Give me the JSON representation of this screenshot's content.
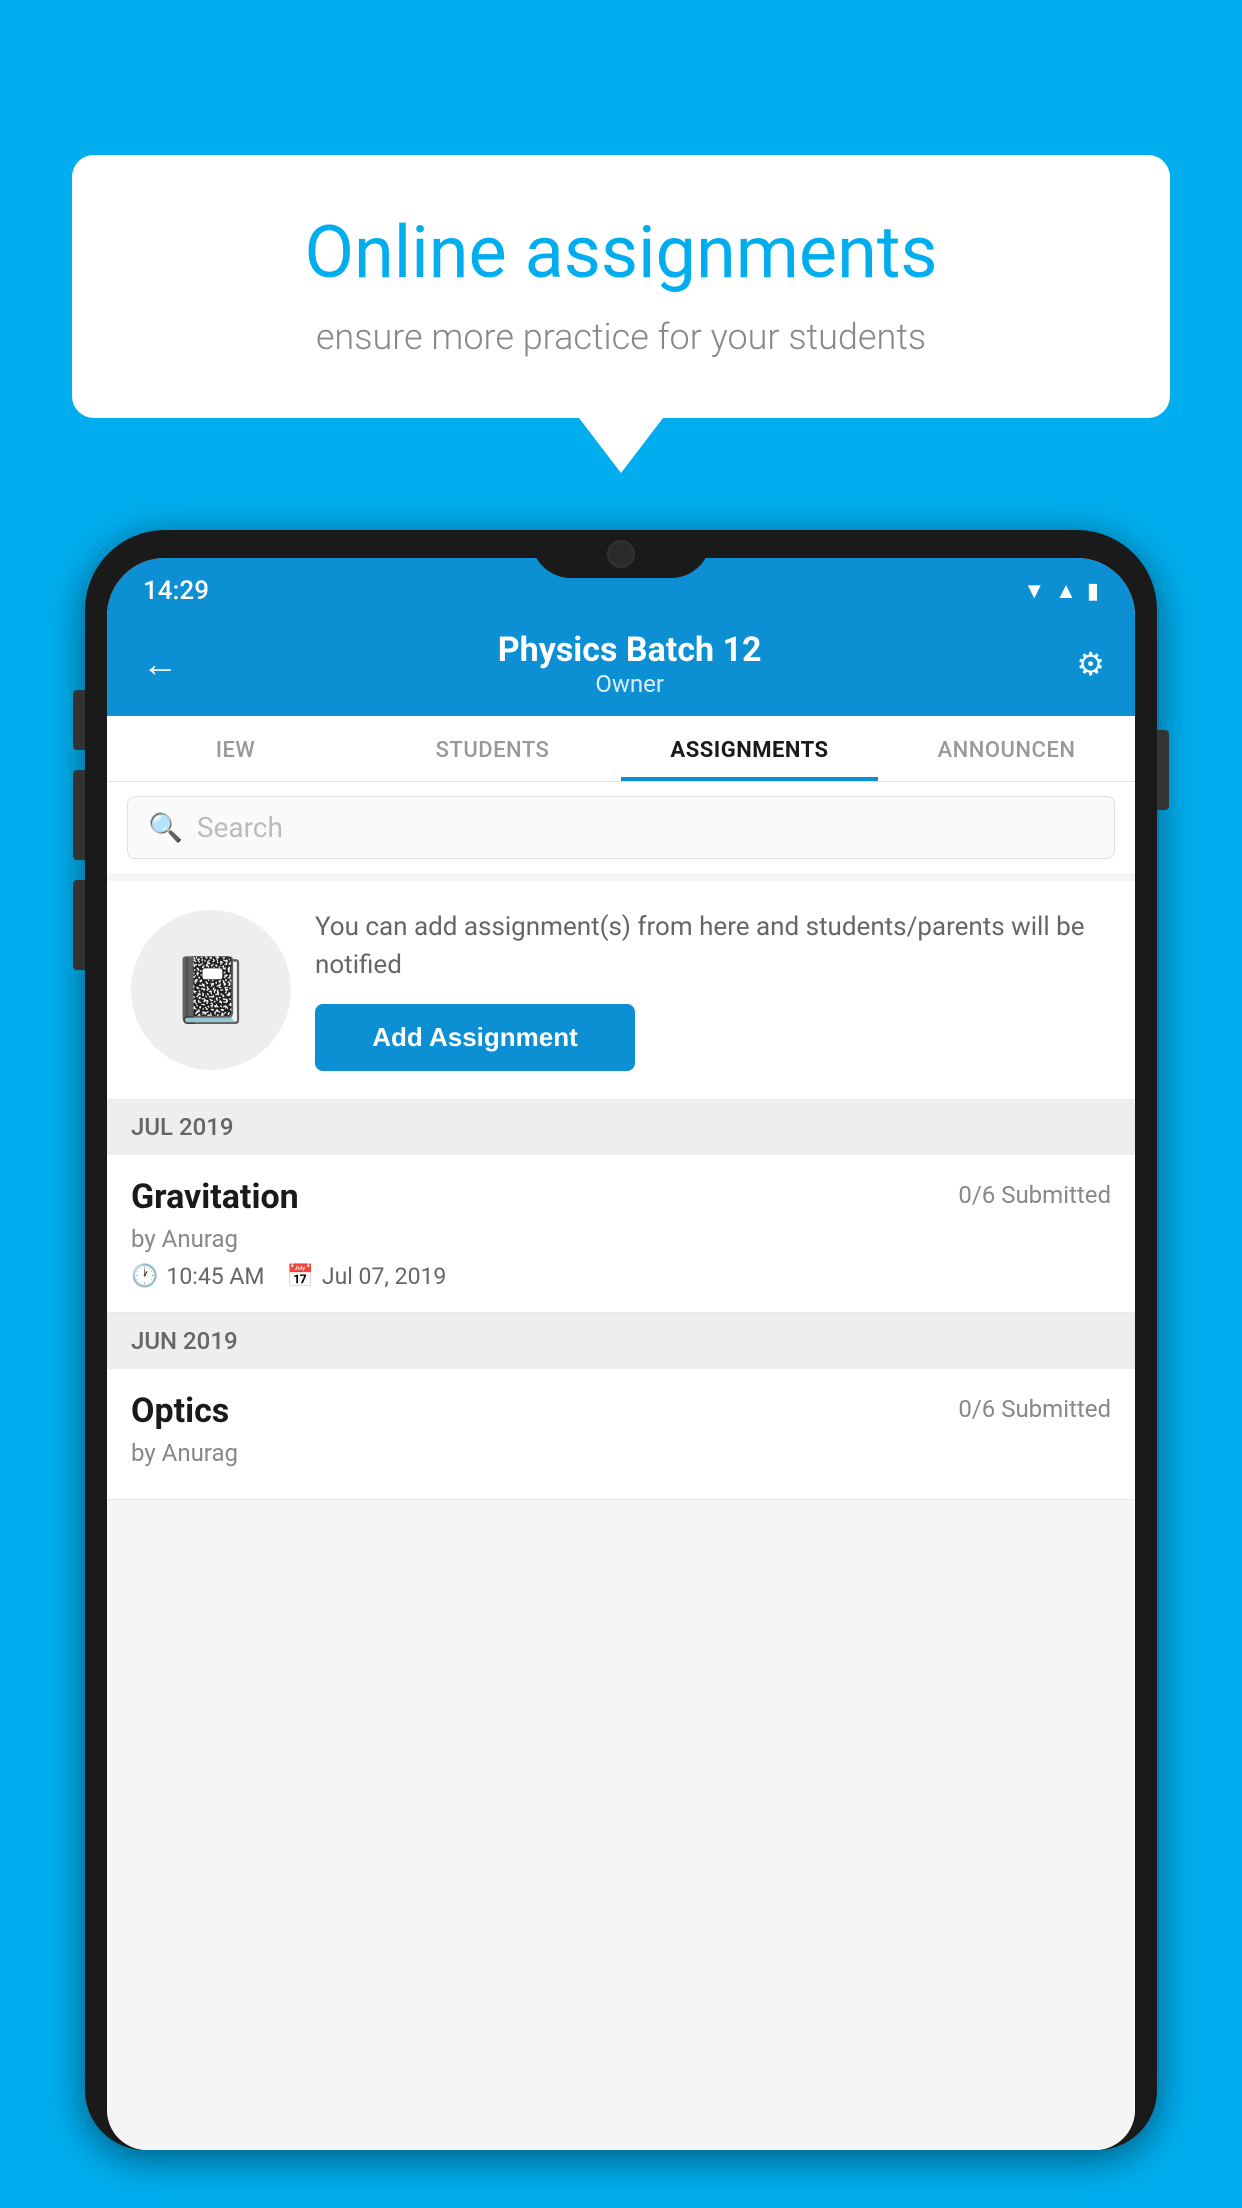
{
  "background_color": "#00AEEF",
  "speech_bubble": {
    "title": "Online assignments",
    "subtitle": "ensure more practice for your students"
  },
  "phone": {
    "status_bar": {
      "time": "14:29",
      "icons": [
        "wifi",
        "signal",
        "battery"
      ]
    },
    "header": {
      "title": "Physics Batch 12",
      "subtitle": "Owner",
      "back_label": "←",
      "settings_label": "⚙"
    },
    "tabs": [
      {
        "label": "IEW",
        "active": false
      },
      {
        "label": "STUDENTS",
        "active": false
      },
      {
        "label": "ASSIGNMENTS",
        "active": true
      },
      {
        "label": "ANNOUNCEN",
        "active": false
      }
    ],
    "search": {
      "placeholder": "Search"
    },
    "promo": {
      "description": "You can add assignment(s) from here and students/parents will be notified",
      "button_label": "Add Assignment"
    },
    "sections": [
      {
        "month": "JUL 2019",
        "assignments": [
          {
            "name": "Gravitation",
            "submitted": "0/6 Submitted",
            "author": "by Anurag",
            "time": "10:45 AM",
            "date": "Jul 07, 2019"
          }
        ]
      },
      {
        "month": "JUN 2019",
        "assignments": [
          {
            "name": "Optics",
            "submitted": "0/6 Submitted",
            "author": "by Anurag",
            "time": "",
            "date": ""
          }
        ]
      }
    ]
  }
}
